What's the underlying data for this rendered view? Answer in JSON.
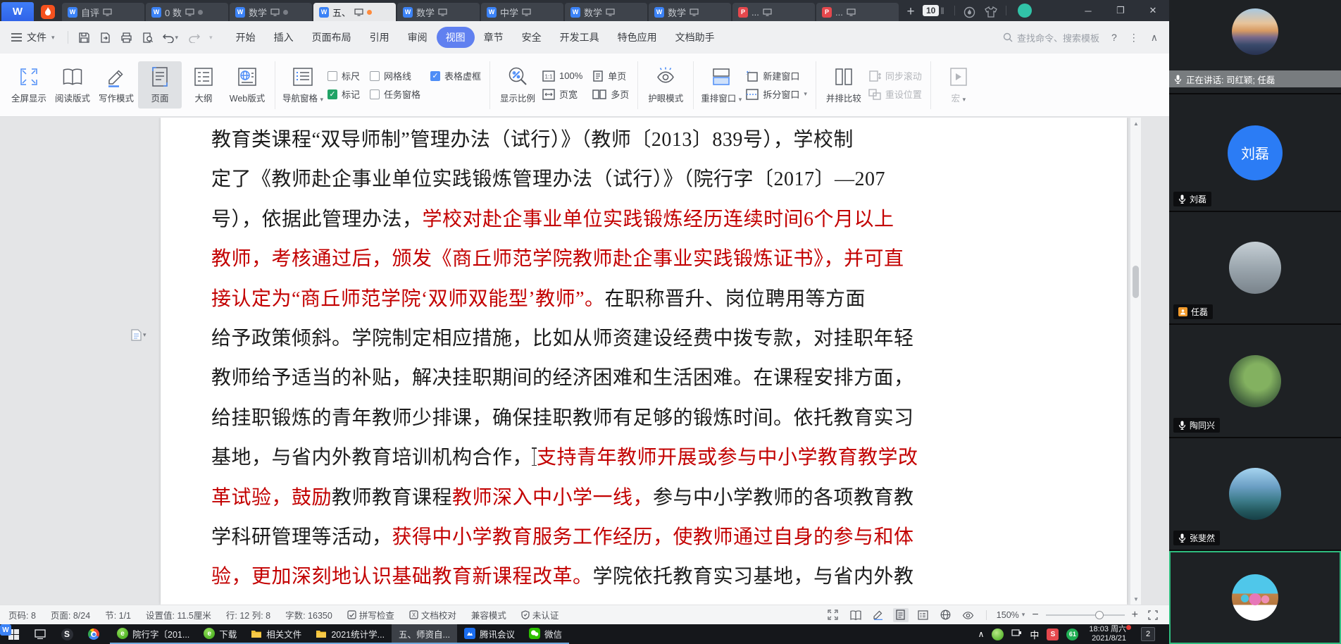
{
  "titlebar": {
    "home_label": "W",
    "tabs": [
      {
        "label": "自评",
        "type": "doc",
        "dot": "none",
        "active": false
      },
      {
        "label": "0 数",
        "type": "doc",
        "dot": "gray",
        "active": false
      },
      {
        "label": "数学",
        "type": "doc",
        "dot": "gray",
        "active": false
      },
      {
        "label": "五、",
        "type": "doc",
        "dot": "orange",
        "active": true
      },
      {
        "label": "数学",
        "type": "doc",
        "dot": "none",
        "active": false
      },
      {
        "label": "中学",
        "type": "doc",
        "dot": "none",
        "active": false
      },
      {
        "label": "数学",
        "type": "doc",
        "dot": "none",
        "active": false
      },
      {
        "label": "数学",
        "type": "doc",
        "dot": "none",
        "active": false
      },
      {
        "label": "...",
        "type": "pdf",
        "dot": "none",
        "active": false
      },
      {
        "label": "...",
        "type": "pdf",
        "dot": "none",
        "active": false
      }
    ],
    "new_tab_label": "+",
    "tab_count_badge": "10",
    "minimize_glyph": "─",
    "maximize_glyph": "❐",
    "close_glyph": "✕"
  },
  "menubar": {
    "file_label": "文件",
    "menus": [
      "开始",
      "插入",
      "页面布局",
      "引用",
      "审阅",
      "视图",
      "章节",
      "安全",
      "开发工具",
      "特色应用",
      "文档助手"
    ],
    "active_menu": "视图",
    "search_placeholder": "查找命令、搜索模板",
    "help_glyph": "?",
    "more_glyph": "⋮",
    "collapse_glyph": "∧"
  },
  "ribbon": {
    "view_modes": [
      {
        "label": "全屏显示",
        "icon": "fullscreen",
        "selected": false
      },
      {
        "label": "阅读版式",
        "icon": "book",
        "selected": false
      },
      {
        "label": "写作模式",
        "icon": "pencil",
        "selected": false
      },
      {
        "label": "页面",
        "icon": "page",
        "selected": true
      },
      {
        "label": "大纲",
        "icon": "outline",
        "selected": false
      },
      {
        "label": "Web版式",
        "icon": "web",
        "selected": false
      }
    ],
    "nav_pane": {
      "label": "导航窗格",
      "caret": true
    },
    "checkboxes": [
      {
        "label": "标尺",
        "checked": false,
        "style": ""
      },
      {
        "label": "标记",
        "checked": true,
        "style": "green"
      },
      {
        "label": "网格线",
        "checked": false,
        "style": ""
      },
      {
        "label": "任务窗格",
        "checked": false,
        "style": ""
      },
      {
        "label": "表格虚框",
        "checked": true,
        "style": "blue"
      }
    ],
    "zoom_big": {
      "label": "显示比例"
    },
    "zoom_items": [
      {
        "label": "100%",
        "icon": "one2one"
      },
      {
        "label": "页宽",
        "icon": "pagewidth"
      },
      {
        "label": "单页",
        "icon": "onepage"
      },
      {
        "label": "多页",
        "icon": "multipage"
      }
    ],
    "eye_label": "护眼模式",
    "window_big": {
      "label": "重排窗口",
      "caret": true
    },
    "window_items": [
      {
        "label": "新建窗口",
        "icon": "newwin",
        "caret": false
      },
      {
        "label": "拆分窗口",
        "icon": "splitwin",
        "caret": true
      }
    ],
    "compare_big": {
      "label": "并排比较"
    },
    "compare_items": [
      {
        "label": "同步滚动",
        "icon": "sync",
        "disabled": true
      },
      {
        "label": "重设位置",
        "icon": "resetpos",
        "disabled": true
      }
    ],
    "macro": {
      "label": "宏",
      "caret": true,
      "disabled": true
    }
  },
  "document": {
    "lines": [
      {
        "runs": [
          {
            "t": "教育类课程“双导师制”管理办法（试行）》（教师〔2013〕839号），学校制",
            "c": "k"
          }
        ]
      },
      {
        "runs": [
          {
            "t": "定了《教师赴企事业单位实践锻炼管理办法（试行）》（院行字〔2017〕—207",
            "c": "k"
          }
        ]
      },
      {
        "runs": [
          {
            "t": "号），依据此管理办法，",
            "c": "k"
          },
          {
            "t": "学校对赴企事业单位实践锻炼经历连续时间6个月以上",
            "c": "r"
          }
        ]
      },
      {
        "runs": [
          {
            "t": "教师，考核通过后，颁发《商丘师范学院教师赴企事业实践锻炼证书》，并可直",
            "c": "r"
          }
        ]
      },
      {
        "runs": [
          {
            "t": "接认定为“商丘师范学院‘双师双能型’教师”。",
            "c": "r"
          },
          {
            "t": "在职称晋升、岗位聘用等方面",
            "c": "k"
          }
        ]
      },
      {
        "runs": [
          {
            "t": "给予政策倾斜。学院制定相应措施，比如从师资建设经费中拨专款，对挂职年轻",
            "c": "k"
          }
        ]
      },
      {
        "runs": [
          {
            "t": "教师给予适当的补贴，解决挂职期间的经济困难和生活困难。在课程安排方面，",
            "c": "k"
          }
        ]
      },
      {
        "runs": [
          {
            "t": "给挂职锻炼的青年教师少排课，确保挂职教师有足够的锻炼时间。依托教育实习",
            "c": "k"
          }
        ]
      },
      {
        "runs": [
          {
            "t": "基地，与省内外教育培训机构合作，",
            "c": "k"
          },
          {
            "t": "",
            "c": "cursor"
          },
          {
            "t": "支持青年教师开展或参与中小学教育教学改",
            "c": "r"
          }
        ]
      },
      {
        "runs": [
          {
            "t": "革试验，鼓励",
            "c": "r"
          },
          {
            "t": "教师教育课程",
            "c": "k"
          },
          {
            "t": "教师深入中小学一线，",
            "c": "r"
          },
          {
            "t": "参与中小学教师的各项教育教",
            "c": "k"
          }
        ]
      },
      {
        "runs": [
          {
            "t": "学科研管理等活动，",
            "c": "k"
          },
          {
            "t": "获得中小学教育服务工作经历，使教师通过自身的参与和体",
            "c": "r"
          }
        ]
      },
      {
        "runs": [
          {
            "t": "验，更加深刻地认识基础教育新课程改革。",
            "c": "r"
          },
          {
            "t": "学院依托教育实习基地，与省内外教",
            "c": "k"
          }
        ]
      }
    ],
    "text_color": "#1c1c1c",
    "highlight_color": "#c30000"
  },
  "statusbar": {
    "items": [
      {
        "label": "页码: 8",
        "icon": ""
      },
      {
        "label": "页面: 8/24",
        "icon": ""
      },
      {
        "label": "节: 1/1",
        "icon": ""
      },
      {
        "label": "设置值: 11.5厘米",
        "icon": ""
      },
      {
        "label": "行: 12  列: 8",
        "icon": ""
      },
      {
        "label": "字数: 16350",
        "icon": ""
      },
      {
        "label": "拼写检查",
        "icon": "spell"
      },
      {
        "label": "文档校对",
        "icon": "proof"
      },
      {
        "label": "兼容模式",
        "icon": ""
      },
      {
        "label": "未认证",
        "icon": "shield"
      }
    ],
    "zoom_level": "150%",
    "zoom_minus": "−",
    "zoom_plus": "+"
  },
  "taskbar": {
    "left_icons": [
      "start",
      "taskview",
      "sapp",
      "chrome"
    ],
    "apps": [
      {
        "label": "院行字〔201...",
        "icon": "greene",
        "glyph": "e",
        "running": true,
        "active": false
      },
      {
        "label": "下载",
        "icon": "greene",
        "glyph": "e",
        "running": true,
        "active": false
      },
      {
        "label": "相关文件",
        "icon": "folder",
        "glyph": "",
        "running": true,
        "active": false
      },
      {
        "label": "2021统计学...",
        "icon": "folder",
        "glyph": "",
        "running": true,
        "active": false
      },
      {
        "label": "五、师资自...",
        "icon": "wps",
        "glyph": "W",
        "running": true,
        "active": true
      },
      {
        "label": "腾讯会议",
        "icon": "meeting",
        "glyph": "",
        "running": true,
        "active": false
      },
      {
        "label": "微信",
        "icon": "wechat",
        "glyph": "",
        "running": true,
        "active": false
      }
    ],
    "tray_chevron": "∧",
    "tray_input_method": "中",
    "tray_sogou": "S",
    "tray_app61": "61",
    "clock_time": "18:03 周六",
    "clock_date": "2021/8/21",
    "notify_badge": "2"
  },
  "sidebar": {
    "speaking_label": "正在讲话: 司红颖; 任磊",
    "participants": [
      {
        "name": "",
        "avatar": "sunset",
        "label_icon": "",
        "has_speakbar": true,
        "selected": false
      },
      {
        "name": "刘磊",
        "avatar": "initial",
        "label_icon": "mic",
        "has_speakbar": false,
        "selected": false
      },
      {
        "name": "任磊",
        "avatar": "blur",
        "label_icon": "member",
        "has_speakbar": false,
        "selected": false
      },
      {
        "name": "陶同兴",
        "avatar": "plant",
        "label_icon": "mic",
        "has_speakbar": false,
        "selected": false
      },
      {
        "name": "张斐然",
        "avatar": "lake",
        "label_icon": "mic",
        "has_speakbar": false,
        "selected": false
      },
      {
        "name": "",
        "avatar": "cartoon",
        "label_icon": "",
        "has_speakbar": false,
        "selected": true
      }
    ],
    "initial_avatar_text": "刘磊"
  }
}
